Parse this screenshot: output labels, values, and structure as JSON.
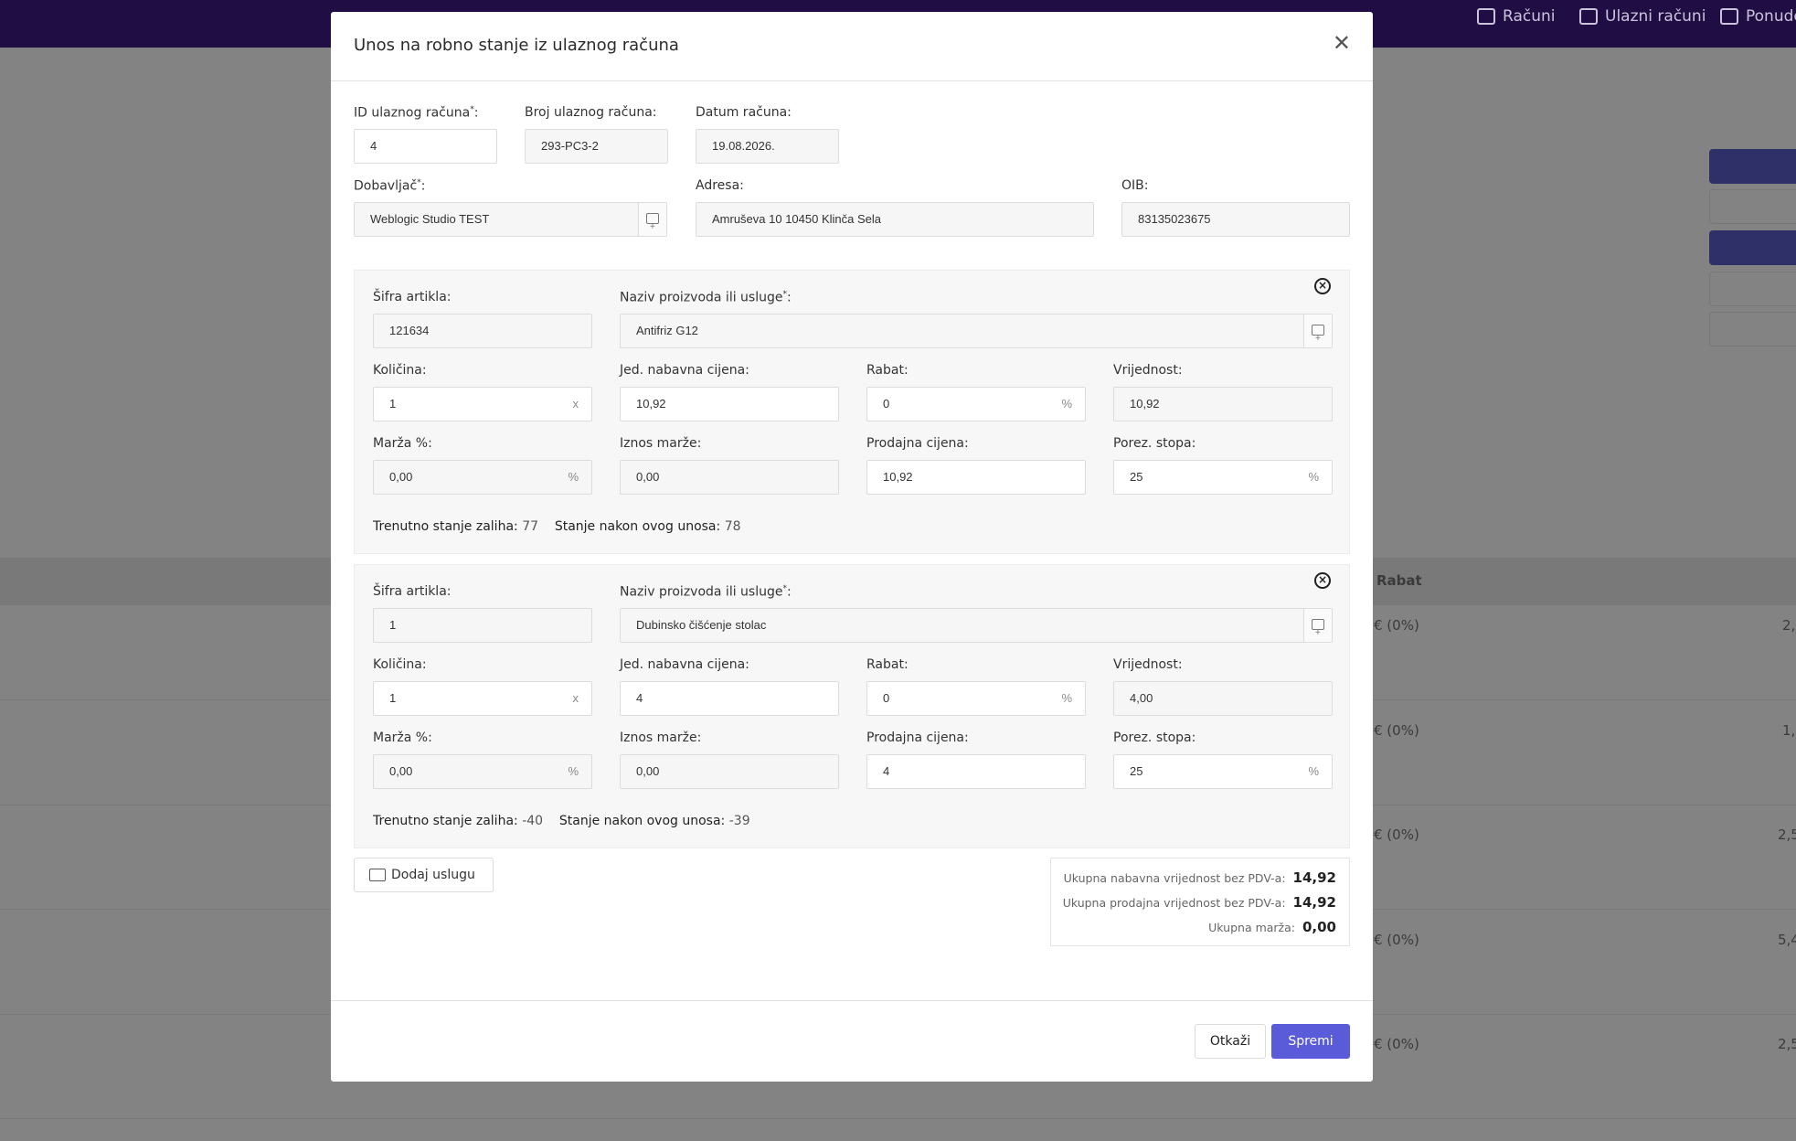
{
  "nav": {
    "items": [
      {
        "label": "Računi",
        "icon": "receipt-icon"
      },
      {
        "label": "Ulazni računi",
        "icon": "list-check-icon"
      },
      {
        "label": "Ponude",
        "icon": "list-check-icon"
      }
    ]
  },
  "background_table": {
    "header_rabat": "Rabat",
    "rows": [
      {
        "rabat": "€ (0%)",
        "value": "2,"
      },
      {
        "rabat": "€ (0%)",
        "value": "1,"
      },
      {
        "rabat": "€ (0%)",
        "value": "2,5"
      },
      {
        "rabat": "€ (0%)",
        "value": "5,4"
      },
      {
        "rabat": "€ (0%)",
        "value": "2,5"
      }
    ]
  },
  "modal": {
    "title": "Unos na robno stanje iz ulaznog računa",
    "close_icon": "close-icon",
    "header_fields": {
      "id_label": "ID ulaznog računa",
      "id_required": "*",
      "id_colon": ":",
      "id_value": "4",
      "broj_label": "Broj ulaznog računa:",
      "broj_value": "293-PC3-2",
      "datum_label": "Datum računa:",
      "datum_value": "19.08.2026.",
      "dobavljac_label": "Dobavljač",
      "dobavljac_required": "*",
      "dobavljac_colon": ":",
      "dobavljac_value": "Weblogic Studio TEST",
      "adresa_label": "Adresa:",
      "adresa_value": "Amruševa 10 10450 Klinča Sela",
      "oib_label": "OIB:",
      "oib_value": "83135023675"
    },
    "item_labels": {
      "sifra": "Šifra artikla:",
      "naziv": "Naziv proizvoda ili usluge",
      "naziv_required": "*",
      "naziv_colon": ":",
      "kolicina": "Količina:",
      "jed_cijena": "Jed. nabavna cijena:",
      "rabat": "Rabat:",
      "vrijednost": "Vrijednost:",
      "marza": "Marža %:",
      "iznos_marze": "Iznos marže:",
      "prodajna": "Prodajna cijena:",
      "porez": "Porez. stopa:",
      "trenutno": "Trenutno stanje zaliha:",
      "nakon": "Stanje nakon ovog unosa:",
      "x_suffix": "x",
      "pct_suffix": "%"
    },
    "items": [
      {
        "sifra": "121634",
        "naziv": "Antifriz G12",
        "kolicina": "1",
        "jed_cijena": "10,92",
        "rabat": "0",
        "vrijednost": "10,92",
        "marza": "0,00",
        "iznos_marze": "0,00",
        "prodajna": "10,92",
        "porez": "25",
        "trenutno": "77",
        "nakon": "78"
      },
      {
        "sifra": "1",
        "naziv": "Dubinsko čišćenje stolac",
        "kolicina": "1",
        "jed_cijena": "4",
        "rabat": "0",
        "vrijednost": "4,00",
        "marza": "0,00",
        "iznos_marze": "0,00",
        "prodajna": "4",
        "porez": "25",
        "trenutno": "-40",
        "nakon": "-39"
      }
    ],
    "add_button": "Dodaj uslugu",
    "totals": {
      "nabavna_label": "Ukupna nabavna vrijednost bez PDV-a:",
      "nabavna_value": "14,92",
      "prodajna_label": "Ukupna prodajna vrijednost bez PDV-a:",
      "prodajna_value": "14,92",
      "marza_label": "Ukupna marža:",
      "marza_value": "0,00"
    },
    "cancel_button": "Otkaži",
    "save_button": "Spremi"
  },
  "colors": {
    "topbar": "#1f0d44",
    "primary": "#5a5bd9",
    "overlay": "#838383"
  }
}
